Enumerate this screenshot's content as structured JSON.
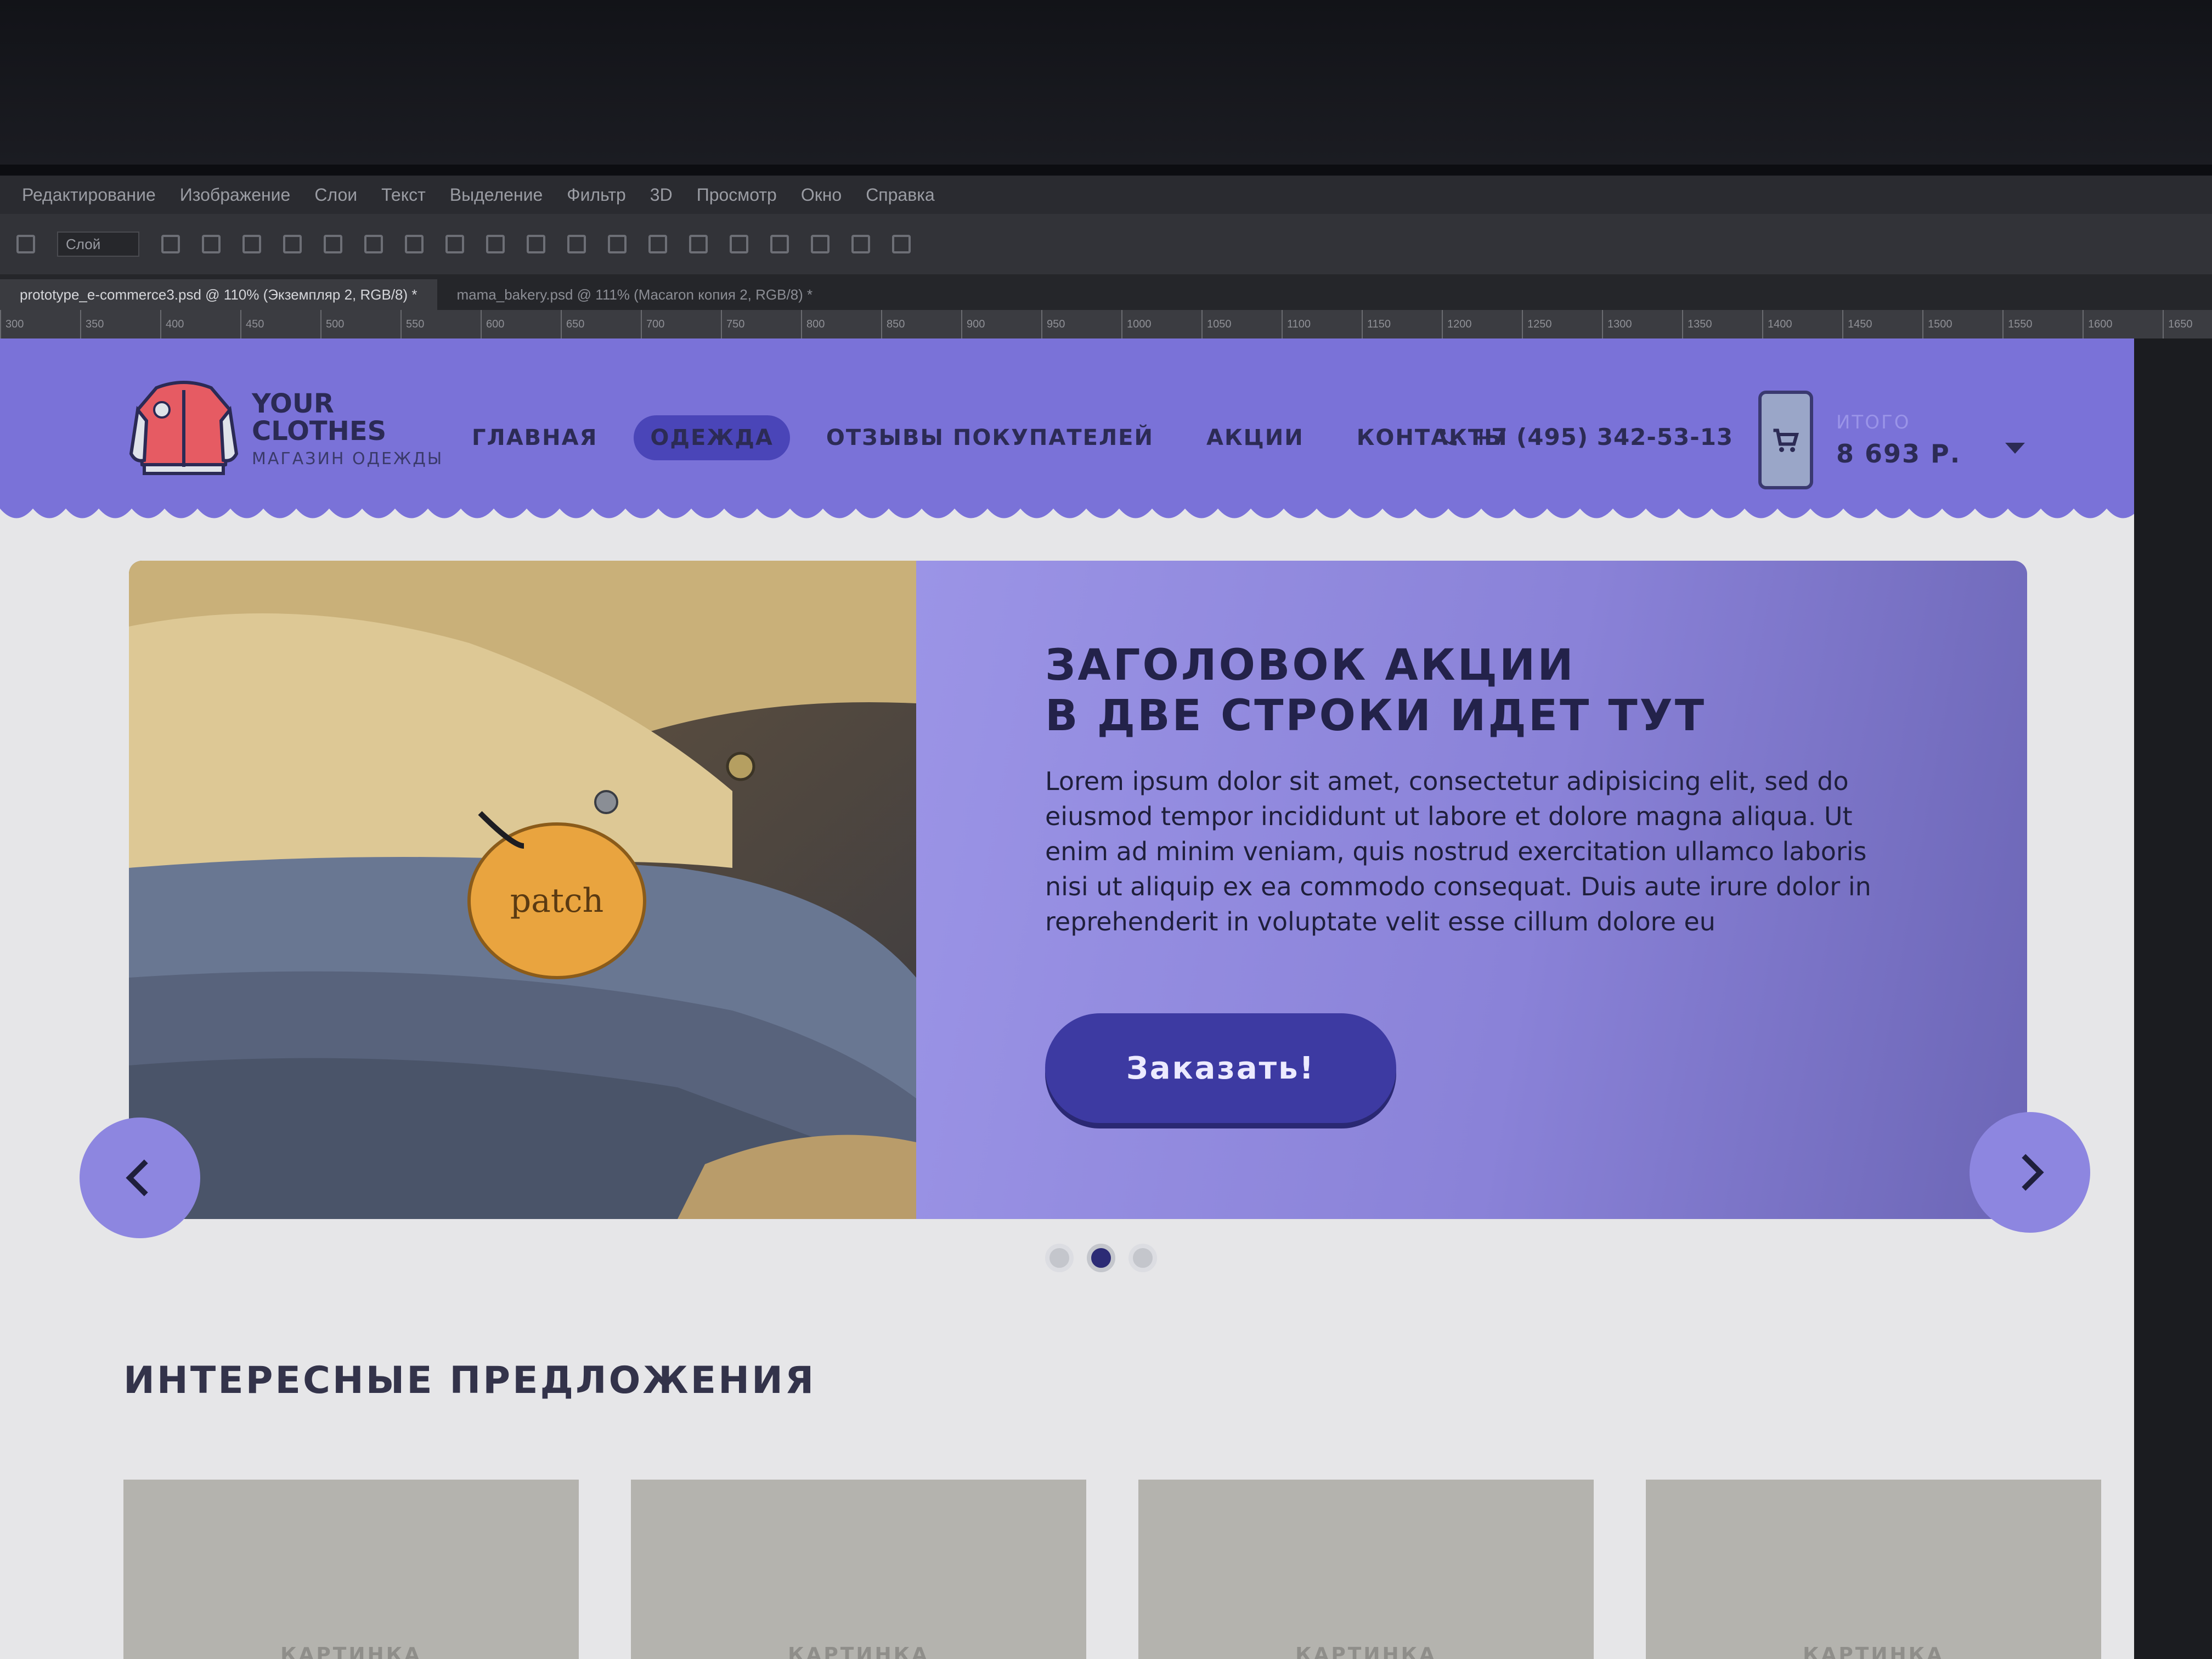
{
  "photoshop": {
    "menu": [
      "Редактирование",
      "Изображение",
      "Слои",
      "Текст",
      "Выделение",
      "Фильтр",
      "3D",
      "Просмотр",
      "Окно",
      "Справка"
    ],
    "options_select": "Слой",
    "tabs": [
      "prototype_e-commerce3.psd @ 110% (Экземпляр 2, RGB/8) *",
      "mama_bakery.psd @ 111% (Macaron копия 2, RGB/8) *"
    ],
    "ruler_marks": [
      "300",
      "350",
      "400",
      "450",
      "500",
      "550",
      "600",
      "650",
      "700",
      "750",
      "800",
      "850",
      "900",
      "950",
      "1000",
      "1050",
      "1100",
      "1150",
      "1200",
      "1250",
      "1300",
      "1350",
      "1400",
      "1450",
      "1500",
      "1550",
      "1600",
      "1650"
    ]
  },
  "site": {
    "logo": {
      "brand_line1": "YOUR",
      "brand_line2": "CLOTHES",
      "tagline": "МАГАЗИН ОДЕЖДЫ"
    },
    "nav": [
      "ГЛАВНАЯ",
      "ОДЕЖДА",
      "ОТЗЫВЫ ПОКУПАТЕЛЕЙ",
      "АКЦИИ",
      "КОНТАКТЫ"
    ],
    "phone": "+7 (495) 342-53-13",
    "cart": {
      "label": "ИТОГО",
      "total": "8 693 Р."
    },
    "slide": {
      "title_line1": "ЗАГОЛОВОК АКЦИИ",
      "title_line2": "В ДВЕ СТРОКИ ИДЕТ ТУТ",
      "body": "Lorem ipsum dolor sit amet, consectetur adipisicing elit, sed do eiusmod tempor incididunt ut labore et dolore magna aliqua. Ut enim ad minim veniam, quis nostrud exercitation ullamco laboris nisi ut aliquip ex ea commodo consequat. Duis aute irure dolor in reprehenderit in voluptate velit esse cillum dolore eu",
      "button": "Заказать!",
      "patch_label": "patch",
      "dots_active_index": 2
    },
    "offers_title": "ИНТЕРЕСНЫЕ ПРЕДЛОЖЕНИЯ",
    "card_placeholder": "КАРТИНКА",
    "colors": {
      "header": "#7a72d8",
      "accent": "#3d3aa2",
      "panel": "#8a82d8"
    }
  }
}
